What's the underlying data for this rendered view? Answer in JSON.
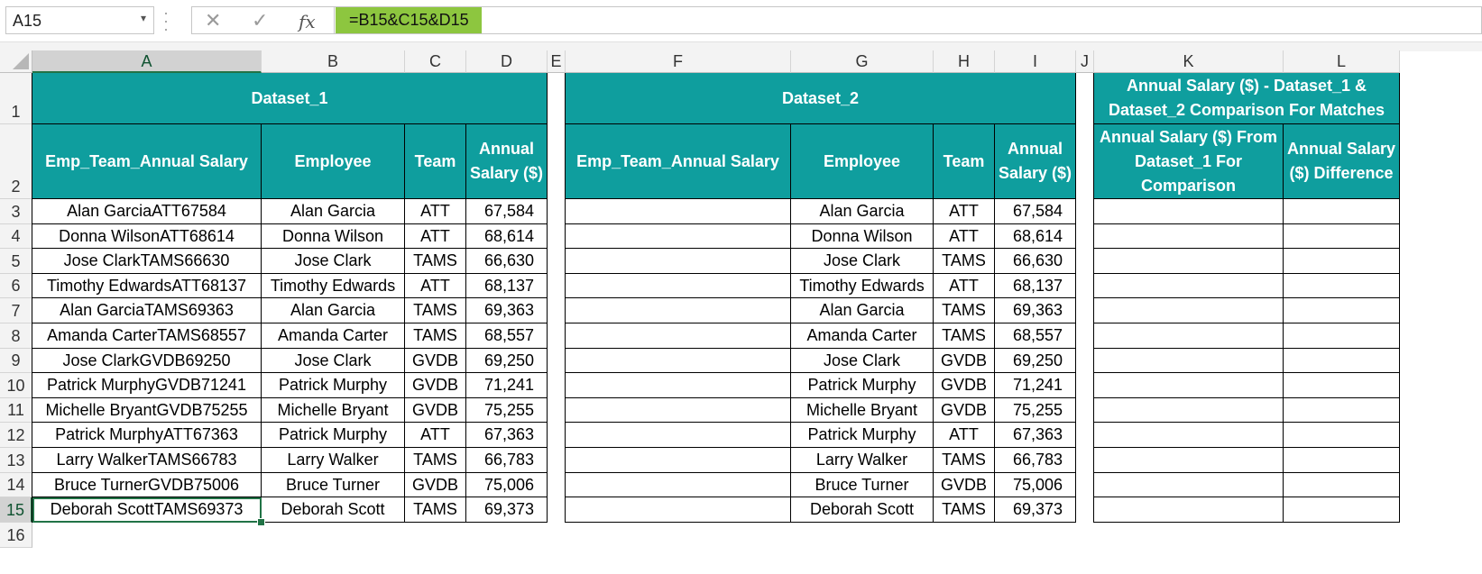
{
  "formula_bar": {
    "name_box": "A15",
    "cancel_icon": "✕",
    "enter_icon": "✓",
    "fx_label": "fx",
    "formula": "=B15&C15&D15"
  },
  "columns": [
    "A",
    "B",
    "C",
    "D",
    "E",
    "F",
    "G",
    "H",
    "I",
    "J",
    "K",
    "L"
  ],
  "rows": [
    "1",
    "2",
    "3",
    "4",
    "5",
    "6",
    "7",
    "8",
    "9",
    "10",
    "11",
    "12",
    "13",
    "14",
    "15",
    "16"
  ],
  "dataset1": {
    "title": "Dataset_1",
    "headers": [
      "Emp_Team_Annual Salary",
      "Employee",
      "Team",
      "Annual Salary ($)"
    ],
    "rows": [
      [
        "Alan GarciaATT67584",
        "Alan Garcia",
        "ATT",
        "67,584"
      ],
      [
        "Donna WilsonATT68614",
        "Donna Wilson",
        "ATT",
        "68,614"
      ],
      [
        "Jose ClarkTAMS66630",
        "Jose Clark",
        "TAMS",
        "66,630"
      ],
      [
        "Timothy EdwardsATT68137",
        "Timothy Edwards",
        "ATT",
        "68,137"
      ],
      [
        "Alan GarciaTAMS69363",
        "Alan Garcia",
        "TAMS",
        "69,363"
      ],
      [
        "Amanda CarterTAMS68557",
        "Amanda Carter",
        "TAMS",
        "68,557"
      ],
      [
        "Jose ClarkGVDB69250",
        "Jose Clark",
        "GVDB",
        "69,250"
      ],
      [
        "Patrick MurphyGVDB71241",
        "Patrick Murphy",
        "GVDB",
        "71,241"
      ],
      [
        "Michelle BryantGVDB75255",
        "Michelle Bryant",
        "GVDB",
        "75,255"
      ],
      [
        "Patrick MurphyATT67363",
        "Patrick Murphy",
        "ATT",
        "67,363"
      ],
      [
        "Larry WalkerTAMS66783",
        "Larry Walker",
        "TAMS",
        "66,783"
      ],
      [
        "Bruce TurnerGVDB75006",
        "Bruce Turner",
        "GVDB",
        "75,006"
      ],
      [
        "Deborah ScottTAMS69373",
        "Deborah Scott",
        "TAMS",
        "69,373"
      ]
    ]
  },
  "dataset2": {
    "title": "Dataset_2",
    "headers": [
      "Emp_Team_Annual Salary",
      "Employee",
      "Team",
      "Annual Salary ($)"
    ],
    "rows": [
      [
        "",
        "Alan Garcia",
        "ATT",
        "67,584"
      ],
      [
        "",
        "Donna Wilson",
        "ATT",
        "68,614"
      ],
      [
        "",
        "Jose Clark",
        "TAMS",
        "66,630"
      ],
      [
        "",
        "Timothy Edwards",
        "ATT",
        "68,137"
      ],
      [
        "",
        "Alan Garcia",
        "TAMS",
        "69,363"
      ],
      [
        "",
        "Amanda Carter",
        "TAMS",
        "68,557"
      ],
      [
        "",
        "Jose Clark",
        "GVDB",
        "69,250"
      ],
      [
        "",
        "Patrick Murphy",
        "GVDB",
        "71,241"
      ],
      [
        "",
        "Michelle Bryant",
        "GVDB",
        "75,255"
      ],
      [
        "",
        "Patrick Murphy",
        "ATT",
        "67,363"
      ],
      [
        "",
        "Larry Walker",
        "TAMS",
        "66,783"
      ],
      [
        "",
        "Bruce Turner",
        "GVDB",
        "75,006"
      ],
      [
        "",
        "Deborah Scott",
        "TAMS",
        "69,373"
      ]
    ]
  },
  "comparison": {
    "title": "Annual Salary ($) - Dataset_1 & Dataset_2 Comparison For Matches",
    "headers": [
      "Annual Salary ($) From Dataset_1 For Comparison",
      "Annual Salary ($) Difference"
    ]
  },
  "colors": {
    "header_fill": "#0f9e9e",
    "header_text": "#ffffff",
    "formula_highlight": "#8dc63f",
    "selection": "#217346"
  }
}
